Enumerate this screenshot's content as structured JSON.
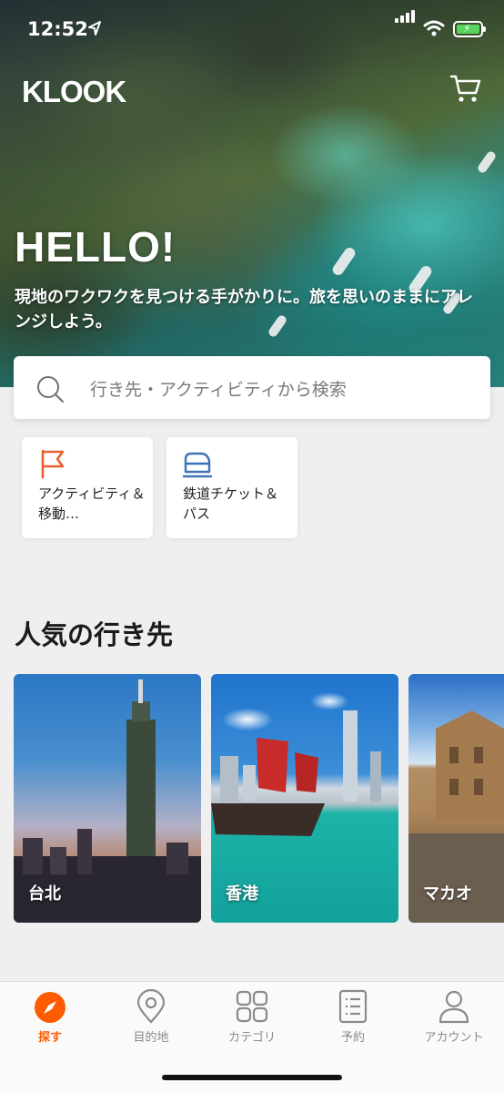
{
  "status_bar": {
    "time": "12:52"
  },
  "header": {
    "logo_text": "KLOOK",
    "cart_icon": "cart-icon"
  },
  "hero": {
    "greeting": "HELLO!",
    "tagline": "現地のワクワクを見つける手がかりに。旅を思いのままにアレンジしよう。"
  },
  "search": {
    "placeholder": "行き先・アクティビティから検索",
    "icon": "search-icon"
  },
  "quick_categories": [
    {
      "label": "アクティビティ＆移動…",
      "icon": "flag-icon"
    },
    {
      "label": "鉄道チケット＆パス",
      "icon": "train-icon"
    }
  ],
  "popular": {
    "title": "人気の行き先",
    "destinations": [
      {
        "name": "台北"
      },
      {
        "name": "香港"
      },
      {
        "name": "マカオ"
      }
    ]
  },
  "tab_bar": {
    "active": "探す",
    "tabs": [
      {
        "label": "探す",
        "icon": "compass-icon"
      },
      {
        "label": "目的地",
        "icon": "location-pin-icon"
      },
      {
        "label": "カテゴリ",
        "icon": "grid-icon"
      },
      {
        "label": "予約",
        "icon": "list-icon"
      },
      {
        "label": "アカウント",
        "icon": "person-icon"
      }
    ]
  },
  "colors": {
    "accent": "#ff5b00",
    "tab_inactive": "#8a8a8a",
    "battery": "#59d35b"
  }
}
